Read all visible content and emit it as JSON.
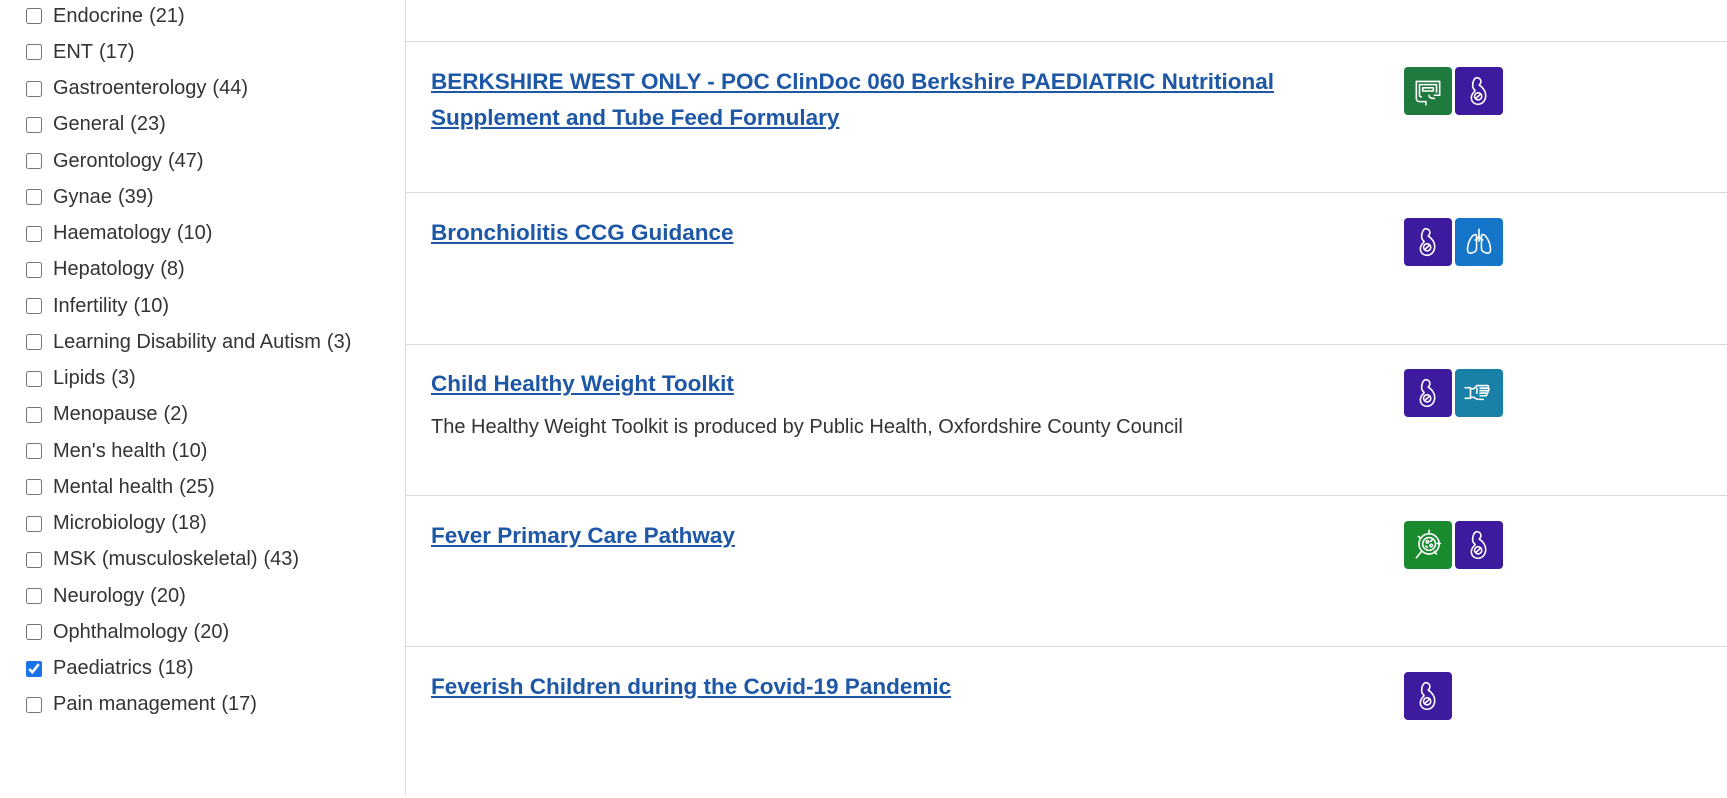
{
  "sidebar": {
    "filters": [
      {
        "label": "Endocrine",
        "count": "(21)",
        "checked": false
      },
      {
        "label": "ENT",
        "count": "(17)",
        "checked": false
      },
      {
        "label": "Gastroenterology",
        "count": "(44)",
        "checked": false
      },
      {
        "label": "General",
        "count": "(23)",
        "checked": false
      },
      {
        "label": "Gerontology",
        "count": "(47)",
        "checked": false
      },
      {
        "label": "Gynae",
        "count": "(39)",
        "checked": false
      },
      {
        "label": "Haematology",
        "count": "(10)",
        "checked": false
      },
      {
        "label": "Hepatology",
        "count": "(8)",
        "checked": false
      },
      {
        "label": "Infertility",
        "count": "(10)",
        "checked": false
      },
      {
        "label": "Learning Disability and Autism",
        "count": "(3)",
        "checked": false
      },
      {
        "label": "Lipids",
        "count": "(3)",
        "checked": false
      },
      {
        "label": "Menopause",
        "count": "(2)",
        "checked": false
      },
      {
        "label": "Men's health",
        "count": "(10)",
        "checked": false
      },
      {
        "label": "Mental health",
        "count": "(25)",
        "checked": false
      },
      {
        "label": "Microbiology",
        "count": "(18)",
        "checked": false
      },
      {
        "label": "MSK (musculoskeletal)",
        "count": "(43)",
        "checked": false
      },
      {
        "label": "Neurology",
        "count": "(20)",
        "checked": false
      },
      {
        "label": "Ophthalmology",
        "count": "(20)",
        "checked": false
      },
      {
        "label": "Paediatrics",
        "count": "(18)",
        "checked": true
      },
      {
        "label": "Pain management",
        "count": "(17)",
        "checked": false
      }
    ]
  },
  "results": [
    {
      "title": "BERKSHIRE WEST ONLY - POC ClinDoc 060 Berkshire PAEDIATRIC Nutritional Supplement and Tube Feed Formulary",
      "description": "",
      "badges": [
        {
          "icon": "intestine-icon",
          "color": "#1f7a3f"
        },
        {
          "icon": "paediatrics-icon",
          "color": "#3d1a9e"
        }
      ]
    },
    {
      "title": "Bronchiolitis CCG Guidance",
      "description": "",
      "badges": [
        {
          "icon": "paediatrics-icon",
          "color": "#3d1a9e"
        },
        {
          "icon": "lungs-icon",
          "color": "#1576c9"
        }
      ]
    },
    {
      "title": "Child Healthy Weight Toolkit",
      "description": "The Healthy Weight Toolkit is produced by Public Health, Oxfordshire County Council",
      "badges": [
        {
          "icon": "paediatrics-icon",
          "color": "#3d1a9e"
        },
        {
          "icon": "hand-icon",
          "color": "#1980a8"
        }
      ]
    },
    {
      "title": "Fever Primary Care Pathway",
      "description": "",
      "badges": [
        {
          "icon": "microbe-icon",
          "color": "#1a8a2e"
        },
        {
          "icon": "paediatrics-icon",
          "color": "#3d1a9e"
        }
      ]
    },
    {
      "title": "Feverish Children during the Covid-19 Pandemic",
      "description": "",
      "badges": [
        {
          "icon": "paediatrics-icon",
          "color": "#3d1a9e"
        }
      ]
    }
  ]
}
